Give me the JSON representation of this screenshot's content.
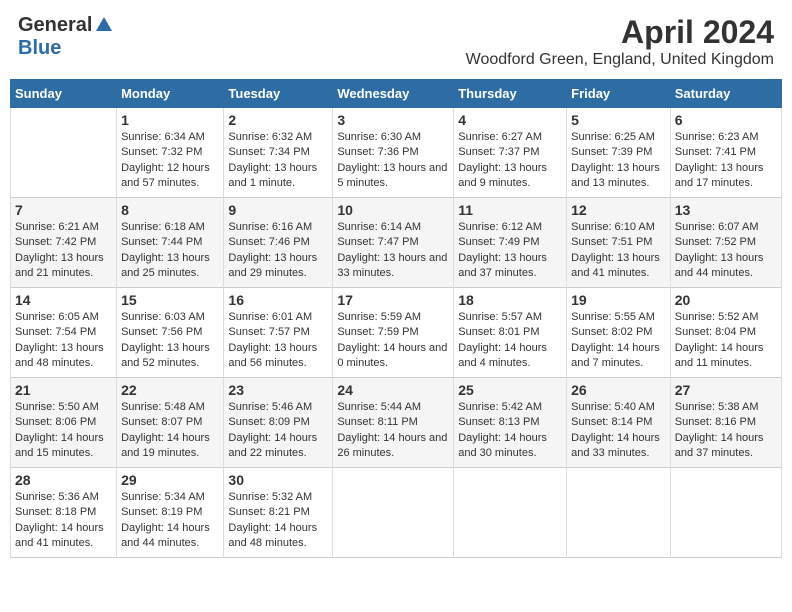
{
  "header": {
    "logo_general": "General",
    "logo_blue": "Blue",
    "month_title": "April 2024",
    "location": "Woodford Green, England, United Kingdom"
  },
  "days_of_week": [
    "Sunday",
    "Monday",
    "Tuesday",
    "Wednesday",
    "Thursday",
    "Friday",
    "Saturday"
  ],
  "weeks": [
    [
      {
        "day": "",
        "sunrise": "",
        "sunset": "",
        "daylight": ""
      },
      {
        "day": "1",
        "sunrise": "Sunrise: 6:34 AM",
        "sunset": "Sunset: 7:32 PM",
        "daylight": "Daylight: 12 hours and 57 minutes."
      },
      {
        "day": "2",
        "sunrise": "Sunrise: 6:32 AM",
        "sunset": "Sunset: 7:34 PM",
        "daylight": "Daylight: 13 hours and 1 minute."
      },
      {
        "day": "3",
        "sunrise": "Sunrise: 6:30 AM",
        "sunset": "Sunset: 7:36 PM",
        "daylight": "Daylight: 13 hours and 5 minutes."
      },
      {
        "day": "4",
        "sunrise": "Sunrise: 6:27 AM",
        "sunset": "Sunset: 7:37 PM",
        "daylight": "Daylight: 13 hours and 9 minutes."
      },
      {
        "day": "5",
        "sunrise": "Sunrise: 6:25 AM",
        "sunset": "Sunset: 7:39 PM",
        "daylight": "Daylight: 13 hours and 13 minutes."
      },
      {
        "day": "6",
        "sunrise": "Sunrise: 6:23 AM",
        "sunset": "Sunset: 7:41 PM",
        "daylight": "Daylight: 13 hours and 17 minutes."
      }
    ],
    [
      {
        "day": "7",
        "sunrise": "Sunrise: 6:21 AM",
        "sunset": "Sunset: 7:42 PM",
        "daylight": "Daylight: 13 hours and 21 minutes."
      },
      {
        "day": "8",
        "sunrise": "Sunrise: 6:18 AM",
        "sunset": "Sunset: 7:44 PM",
        "daylight": "Daylight: 13 hours and 25 minutes."
      },
      {
        "day": "9",
        "sunrise": "Sunrise: 6:16 AM",
        "sunset": "Sunset: 7:46 PM",
        "daylight": "Daylight: 13 hours and 29 minutes."
      },
      {
        "day": "10",
        "sunrise": "Sunrise: 6:14 AM",
        "sunset": "Sunset: 7:47 PM",
        "daylight": "Daylight: 13 hours and 33 minutes."
      },
      {
        "day": "11",
        "sunrise": "Sunrise: 6:12 AM",
        "sunset": "Sunset: 7:49 PM",
        "daylight": "Daylight: 13 hours and 37 minutes."
      },
      {
        "day": "12",
        "sunrise": "Sunrise: 6:10 AM",
        "sunset": "Sunset: 7:51 PM",
        "daylight": "Daylight: 13 hours and 41 minutes."
      },
      {
        "day": "13",
        "sunrise": "Sunrise: 6:07 AM",
        "sunset": "Sunset: 7:52 PM",
        "daylight": "Daylight: 13 hours and 44 minutes."
      }
    ],
    [
      {
        "day": "14",
        "sunrise": "Sunrise: 6:05 AM",
        "sunset": "Sunset: 7:54 PM",
        "daylight": "Daylight: 13 hours and 48 minutes."
      },
      {
        "day": "15",
        "sunrise": "Sunrise: 6:03 AM",
        "sunset": "Sunset: 7:56 PM",
        "daylight": "Daylight: 13 hours and 52 minutes."
      },
      {
        "day": "16",
        "sunrise": "Sunrise: 6:01 AM",
        "sunset": "Sunset: 7:57 PM",
        "daylight": "Daylight: 13 hours and 56 minutes."
      },
      {
        "day": "17",
        "sunrise": "Sunrise: 5:59 AM",
        "sunset": "Sunset: 7:59 PM",
        "daylight": "Daylight: 14 hours and 0 minutes."
      },
      {
        "day": "18",
        "sunrise": "Sunrise: 5:57 AM",
        "sunset": "Sunset: 8:01 PM",
        "daylight": "Daylight: 14 hours and 4 minutes."
      },
      {
        "day": "19",
        "sunrise": "Sunrise: 5:55 AM",
        "sunset": "Sunset: 8:02 PM",
        "daylight": "Daylight: 14 hours and 7 minutes."
      },
      {
        "day": "20",
        "sunrise": "Sunrise: 5:52 AM",
        "sunset": "Sunset: 8:04 PM",
        "daylight": "Daylight: 14 hours and 11 minutes."
      }
    ],
    [
      {
        "day": "21",
        "sunrise": "Sunrise: 5:50 AM",
        "sunset": "Sunset: 8:06 PM",
        "daylight": "Daylight: 14 hours and 15 minutes."
      },
      {
        "day": "22",
        "sunrise": "Sunrise: 5:48 AM",
        "sunset": "Sunset: 8:07 PM",
        "daylight": "Daylight: 14 hours and 19 minutes."
      },
      {
        "day": "23",
        "sunrise": "Sunrise: 5:46 AM",
        "sunset": "Sunset: 8:09 PM",
        "daylight": "Daylight: 14 hours and 22 minutes."
      },
      {
        "day": "24",
        "sunrise": "Sunrise: 5:44 AM",
        "sunset": "Sunset: 8:11 PM",
        "daylight": "Daylight: 14 hours and 26 minutes."
      },
      {
        "day": "25",
        "sunrise": "Sunrise: 5:42 AM",
        "sunset": "Sunset: 8:13 PM",
        "daylight": "Daylight: 14 hours and 30 minutes."
      },
      {
        "day": "26",
        "sunrise": "Sunrise: 5:40 AM",
        "sunset": "Sunset: 8:14 PM",
        "daylight": "Daylight: 14 hours and 33 minutes."
      },
      {
        "day": "27",
        "sunrise": "Sunrise: 5:38 AM",
        "sunset": "Sunset: 8:16 PM",
        "daylight": "Daylight: 14 hours and 37 minutes."
      }
    ],
    [
      {
        "day": "28",
        "sunrise": "Sunrise: 5:36 AM",
        "sunset": "Sunset: 8:18 PM",
        "daylight": "Daylight: 14 hours and 41 minutes."
      },
      {
        "day": "29",
        "sunrise": "Sunrise: 5:34 AM",
        "sunset": "Sunset: 8:19 PM",
        "daylight": "Daylight: 14 hours and 44 minutes."
      },
      {
        "day": "30",
        "sunrise": "Sunrise: 5:32 AM",
        "sunset": "Sunset: 8:21 PM",
        "daylight": "Daylight: 14 hours and 48 minutes."
      },
      {
        "day": "",
        "sunrise": "",
        "sunset": "",
        "daylight": ""
      },
      {
        "day": "",
        "sunrise": "",
        "sunset": "",
        "daylight": ""
      },
      {
        "day": "",
        "sunrise": "",
        "sunset": "",
        "daylight": ""
      },
      {
        "day": "",
        "sunrise": "",
        "sunset": "",
        "daylight": ""
      }
    ]
  ]
}
